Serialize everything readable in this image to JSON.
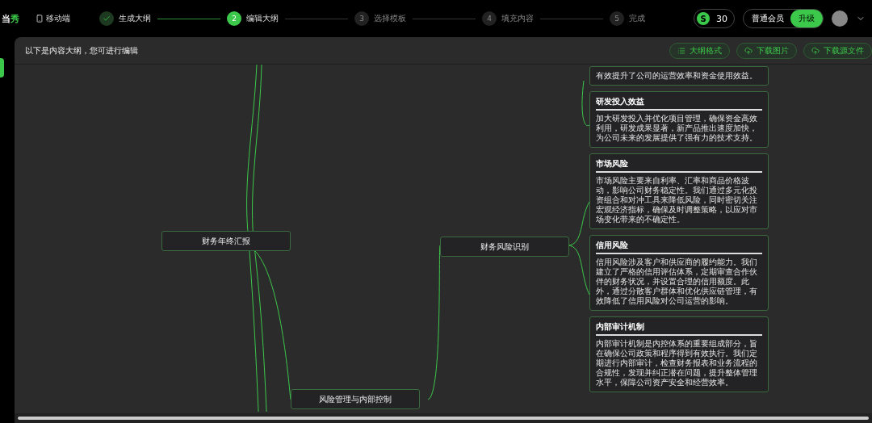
{
  "header": {
    "logo": [
      {
        "text": "当",
        "accent": false
      },
      {
        "text": "秀",
        "accent": true
      }
    ],
    "mobile_link": "移动端",
    "steps": [
      {
        "label": "生成大纲",
        "done": true,
        "selected": false
      },
      {
        "number": "2",
        "label": "编辑大纲",
        "done": false,
        "selected": true
      },
      {
        "number": "3",
        "label": "选择模板",
        "done": false,
        "selected": false
      },
      {
        "number": "4",
        "label": "填充内容",
        "done": false,
        "selected": false
      },
      {
        "number": "5",
        "label": "完成",
        "done": false,
        "selected": false
      }
    ],
    "coin_symbol": "S",
    "coins": "30",
    "membership": "普通会员",
    "upgrade_button": "升级"
  },
  "toolbar": {
    "title": "以下是内容大纲，您可进行编辑",
    "buttons": [
      {
        "label": "大纲格式",
        "kind": "list"
      },
      {
        "label": "下载图片",
        "kind": "cloud"
      },
      {
        "label": "下载源文件",
        "kind": "cloud"
      }
    ]
  },
  "mindmap": {
    "root": "财务年终汇报",
    "branches": [
      {
        "label": "财务风险识别"
      },
      {
        "label": "风险管理与内部控制"
      }
    ],
    "cards": [
      {
        "body": "有效提升了公司的运营效率和资金使用效益。"
      },
      {
        "title": "研发投入效益",
        "body": "加大研发投入并优化项目管理，确保资金高效利用，研发成果显著，新产品推出速度加快，为公司未来的发展提供了强有力的技术支持。"
      },
      {
        "title": "市场风险",
        "body": "市场风险主要来自利率、汇率和商品价格波动，影响公司财务稳定性。我们通过多元化投资组合和对冲工具来降低风险，同时密切关注宏观经济指标，确保及时调整策略，以应对市场变化带来的不确定性。"
      },
      {
        "title": "信用风险",
        "body": "信用风险涉及客户和供应商的履约能力。我们建立了严格的信用评估体系，定期审查合作伙伴的财务状况，并设置合理的信用额度。此外，通过分散客户群体和优化供应链管理，有效降低了信用风险对公司运营的影响。"
      },
      {
        "title": "内部审计机制",
        "body": "内部审计机制是内控体系的重要组成部分，旨在确保公司政策和程序得到有效执行。我们定期进行内部审计，检查财务报表和业务流程的合规性，发现并纠正潜在问题，提升整体管理水平，保障公司资产安全和经营效率。"
      }
    ]
  }
}
